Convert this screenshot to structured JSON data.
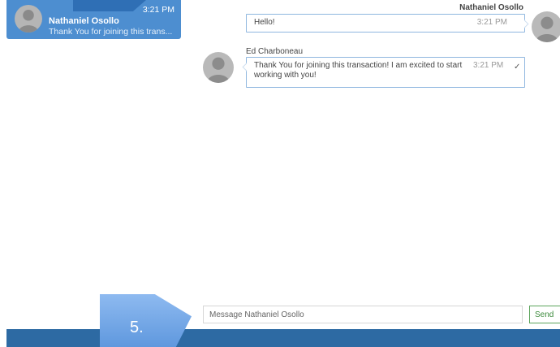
{
  "sidebar": {
    "conversation": {
      "name": "Nathaniel Osollo",
      "preview": "Thank You for joining this trans...",
      "time": "3:21 PM"
    }
  },
  "messages": [
    {
      "sender": "Nathaniel Osollo",
      "text": "Hello!",
      "time": "3:21 PM",
      "side": "right"
    },
    {
      "sender": "Ed Charboneau",
      "text_line1": "Thank You for joining this transaction! I am excited to start",
      "text_line2": "working with you!",
      "time": "3:21 PM",
      "status": "✓",
      "side": "left"
    }
  ],
  "composer": {
    "placeholder": "Message Nathaniel Osollo",
    "send_label": "Send"
  },
  "callout": {
    "step": "5."
  },
  "colors": {
    "accent": "#4d8ed0",
    "bottom_bar": "#2d6aa3",
    "send_green": "#3c8a3c",
    "bubble_border": "#8fb7df"
  },
  "icons": {
    "avatar": "person-silhouette-icon",
    "read": "checkmark-icon"
  }
}
